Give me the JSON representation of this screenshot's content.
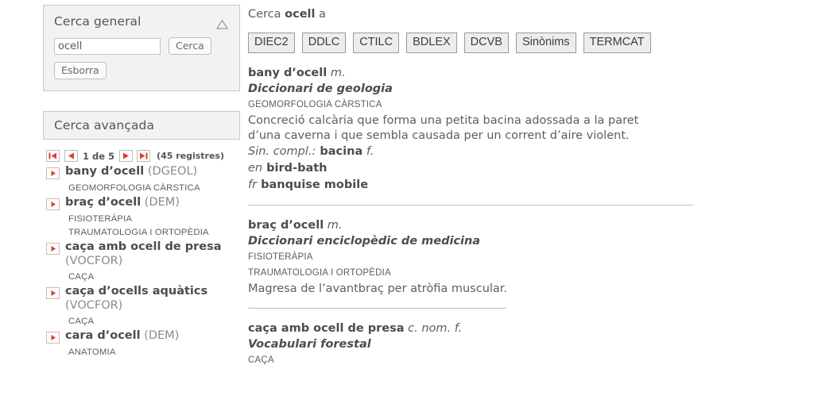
{
  "general_search": {
    "title": "Cerca general",
    "collapse_icon": "triangle-up-icon",
    "input_value": "ocell",
    "input_placeholder": "",
    "search_label": "Cerca",
    "clear_label": "Esborra"
  },
  "advanced_search": {
    "title": "Cerca avançada",
    "pagination": {
      "first_icon": "first-page-icon",
      "prev_icon": "previous-page-icon",
      "next_icon": "next-page-icon",
      "last_icon": "last-page-icon",
      "position_label": "1 de 5",
      "records_label": "(45 registres)"
    },
    "results": [
      {
        "term": "bany d’ocell",
        "source": "(DGEOL)",
        "subjects": [
          "GEOMORFOLOGIA CÀRSTICA"
        ]
      },
      {
        "term": "braç d’ocell",
        "source": "(DEM)",
        "subjects": [
          "FISIOTERÀPIA",
          "TRAUMATOLOGIA I ORTOPÈDIA"
        ]
      },
      {
        "term": "caça amb ocell de presa",
        "source": "(VOCFOR)",
        "subjects": [
          "CAÇA"
        ]
      },
      {
        "term": "caça d’ocells aquàtics",
        "source": "(VOCFOR)",
        "subjects": [
          "CAÇA"
        ]
      },
      {
        "term": "cara d’ocell",
        "source": "(DEM)",
        "subjects": [
          "ANATOMIA"
        ]
      }
    ]
  },
  "main": {
    "headline_prefix": "Cerca ",
    "headline_term": "ocell",
    "headline_suffix": " a",
    "source_buttons": [
      "DIEC2",
      "DDLC",
      "CTILC",
      "BDLEX",
      "DCVB",
      "Sinònims",
      "TERMCAT"
    ],
    "entries": [
      {
        "headword": "bany d’ocell",
        "gram": "m.",
        "source": "Diccionari de geologia",
        "subjects": [
          "GEOMORFOLOGIA CÀRSTICA"
        ],
        "definition": "Concreció calcària que forma una petita bacina adossada a la paret d’una caverna i que sembla causada per un corrent d’aire violent.",
        "extra_lines": [
          {
            "label": "Sin. compl.:",
            "term": "bacina",
            "gram": "f."
          },
          {
            "label": "en",
            "term": "bird-bath",
            "gram": ""
          },
          {
            "label": "fr",
            "term": "banquise mobile",
            "gram": ""
          }
        ],
        "separator": "full"
      },
      {
        "headword": "braç d’ocell",
        "gram": "m.",
        "source": "Diccionari enciclopèdic de medicina",
        "subjects": [
          "FISIOTERÀPIA",
          "TRAUMATOLOGIA I ORTOPÈDIA"
        ],
        "definition": "Magresa de l’avantbraç per atròfia muscular.",
        "extra_lines": [],
        "separator": "short"
      },
      {
        "headword": "caça amb ocell de presa",
        "gram": "c. nom. f.",
        "source": "Vocabulari forestal",
        "subjects": [
          "CAÇA"
        ],
        "definition": "",
        "extra_lines": [],
        "separator": "none"
      }
    ]
  },
  "colors": {
    "accent_red": "#e23b2e",
    "panel_bg": "#f2f2f2",
    "panel_border": "#c9c9c9",
    "text": "#5e5e5e"
  }
}
